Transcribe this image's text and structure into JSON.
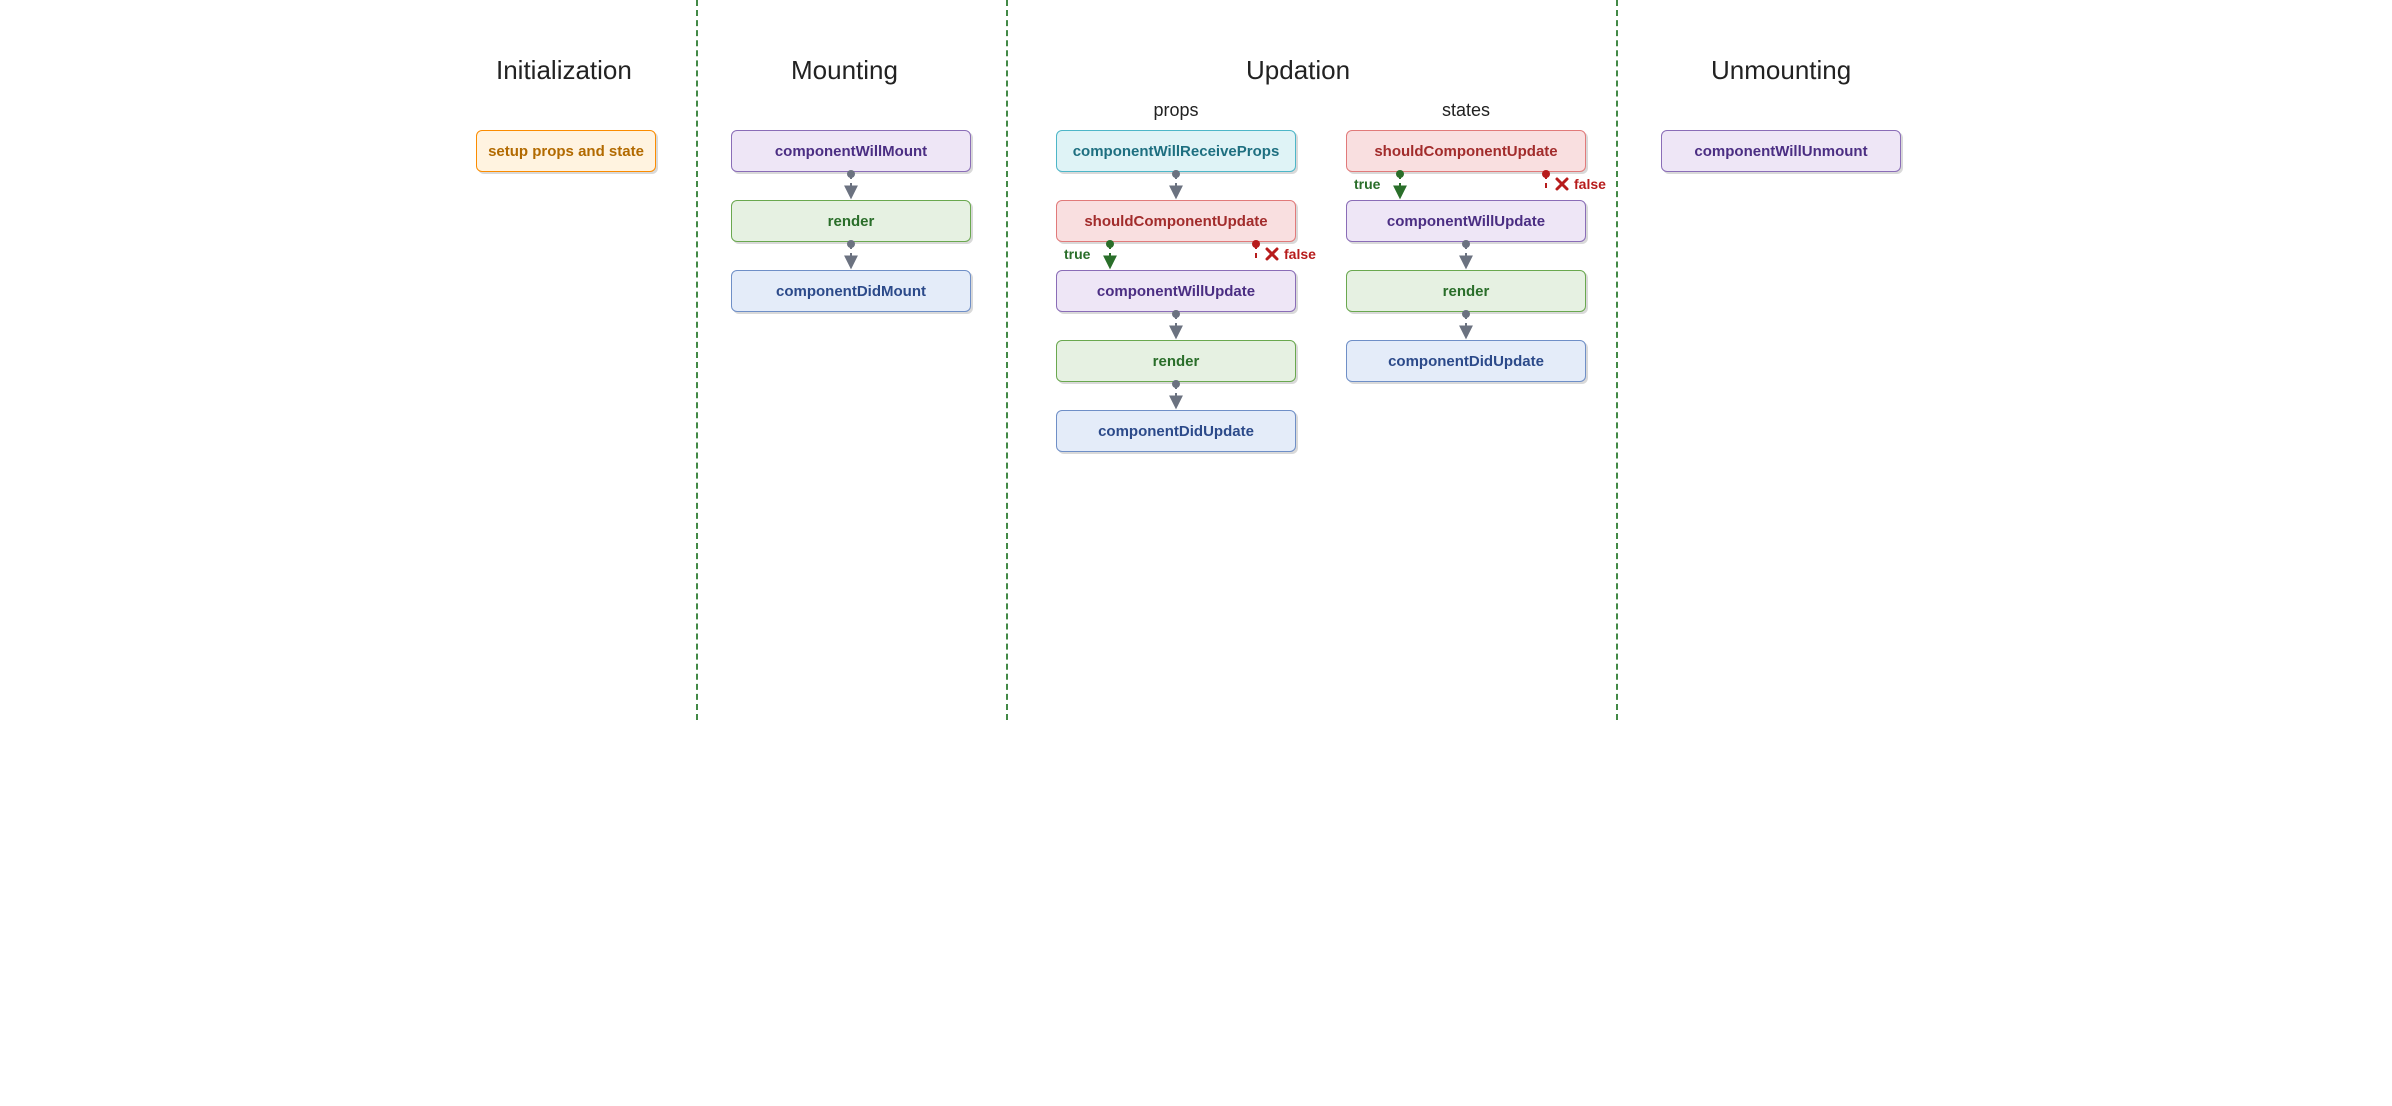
{
  "phases": {
    "initialization": "Initialization",
    "mounting": "Mounting",
    "updation": "Updation",
    "unmounting": "Unmounting"
  },
  "subcolumns": {
    "props": "props",
    "states": "states"
  },
  "nodes": {
    "setup": "setup props and state",
    "componentWillMount": "componentWillMount",
    "renderMount": "render",
    "componentDidMount": "componentDidMount",
    "componentWillReceiveProps": "componentWillReceiveProps",
    "shouldComponentUpdateProps": "shouldComponentUpdate",
    "componentWillUpdateProps": "componentWillUpdate",
    "renderProps": "render",
    "componentDidUpdateProps": "componentDidUpdate",
    "shouldComponentUpdateStates": "shouldComponentUpdate",
    "componentWillUpdateStates": "componentWillUpdate",
    "renderStates": "render",
    "componentDidUpdateStates": "componentDidUpdate",
    "componentWillUnmount": "componentWillUnmount"
  },
  "labels": {
    "true": "true",
    "false": "false"
  },
  "colors": {
    "divider": "#2e7d32",
    "arrowGray": "#6b7280",
    "arrowGreen": "#2a6e2a",
    "arrowRed": "#b71c1c"
  }
}
